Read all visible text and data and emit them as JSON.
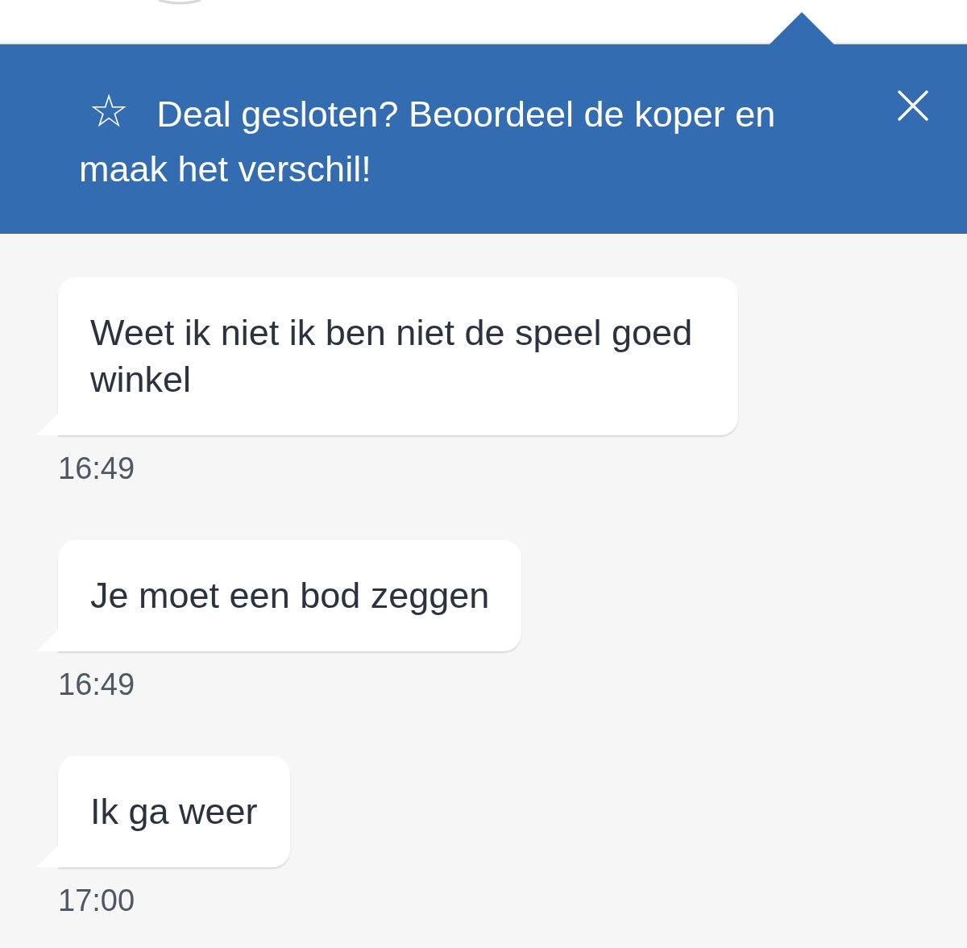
{
  "banner": {
    "icon": "☆",
    "text": "Deal gesloten? Beoordeel de koper en maak het verschil!"
  },
  "messages": [
    {
      "text": "Weet ik niet ik ben niet de speel goed winkel",
      "time": "16:49"
    },
    {
      "text": "Je moet een bod zeggen",
      "time": "16:49"
    },
    {
      "text": "Ik ga weer",
      "time": "17:00"
    }
  ]
}
